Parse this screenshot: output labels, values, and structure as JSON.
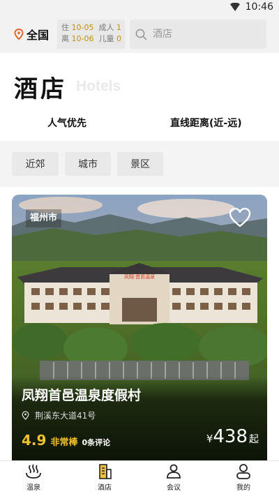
{
  "status": {
    "time": "10:46"
  },
  "header": {
    "location": "全国",
    "dates": {
      "checkin_label": "住",
      "checkin_date": "10-05",
      "checkout_label": "离",
      "checkout_date": "10-06",
      "adult_label": "成人",
      "adult_count": "1",
      "child_label": "儿童",
      "child_count": "0"
    },
    "search_placeholder": "酒店"
  },
  "page": {
    "title": "酒店",
    "subtitle": "Hotels"
  },
  "sort_tabs": [
    "人气优先",
    "直线距离(近-远)"
  ],
  "filters": [
    "近郊",
    "城市",
    "景区"
  ],
  "card": {
    "city": "福州市",
    "name": "凤翔首邑温泉度假村",
    "address": "荆溪东大道41号",
    "score": "4.9",
    "score_label": "非常棒",
    "reviews": "0条评论",
    "price_symbol": "¥",
    "price": "438",
    "price_unit": "起",
    "building_sign": "凤翔·首邑温泉"
  },
  "nav": [
    "温泉",
    "酒店",
    "会议",
    "我的"
  ],
  "colors": {
    "accent": "#f2c12e",
    "date_value": "#c78d12",
    "location_pin": "#e2682b"
  }
}
